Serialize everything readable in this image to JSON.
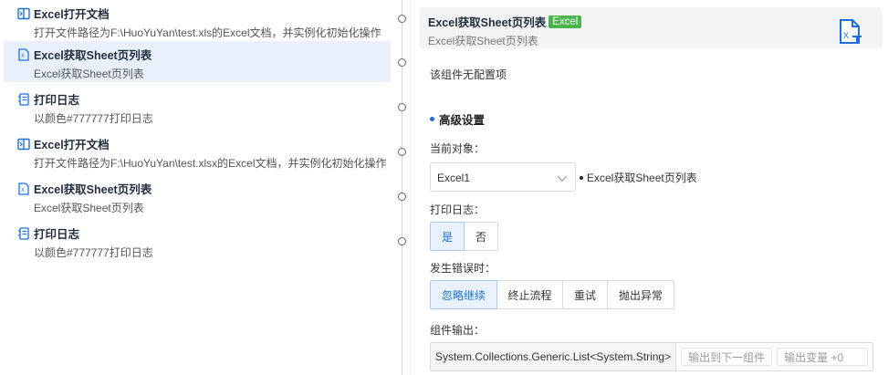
{
  "flow": {
    "steps": [
      {
        "title": "Excel打开文档",
        "desc": "打开文件路径为F:\\HuoYuYan\\test.xls的Excel文档，并实例化初始化操作",
        "icon": "excel-open-icon"
      },
      {
        "title": "Excel获取Sheet页列表",
        "desc": "Excel获取Sheet页列表",
        "icon": "excel-sheet-icon"
      },
      {
        "title": "打印日志",
        "desc": "以颜色#777777打印日志",
        "icon": "log-icon"
      },
      {
        "title": "Excel打开文档",
        "desc": "打开文件路径为F:\\HuoYuYan\\test.xlsx的Excel文档，并实例化初始化操作",
        "icon": "excel-open-icon"
      },
      {
        "title": "Excel获取Sheet页列表",
        "desc": "Excel获取Sheet页列表",
        "icon": "excel-sheet-icon"
      },
      {
        "title": "打印日志",
        "desc": "以颜色#777777打印日志",
        "icon": "log-icon"
      }
    ],
    "selected_index": 1
  },
  "config": {
    "header": {
      "title": "Excel获取Sheet页列表",
      "tag": "Excel",
      "subtitle": "Excel获取Sheet页列表",
      "icon": "excel-sheet-large-icon"
    },
    "no_config": "该组件无配置项",
    "advanced_title": "高级设置",
    "current_object": {
      "label": "当前对象：",
      "value": "Excel1",
      "desc": "Excel获取Sheet页列表"
    },
    "print_log": {
      "label": "打印日志：",
      "options": [
        "是",
        "否"
      ],
      "selected": "是"
    },
    "on_error": {
      "label": "发生错误时：",
      "options": [
        "忽略继续",
        "终止流程",
        "重试",
        "抛出异常"
      ],
      "selected": "忽略继续"
    },
    "output": {
      "label": "组件输出：",
      "type": "System.Collections.Generic.List<System.String>",
      "to_next": "输出到下一组件",
      "var": "输出变量 +0"
    }
  },
  "colors": {
    "accent": "#1e6fd9",
    "selected_bg": "#e9effb",
    "tag_green": "#49b54a"
  }
}
